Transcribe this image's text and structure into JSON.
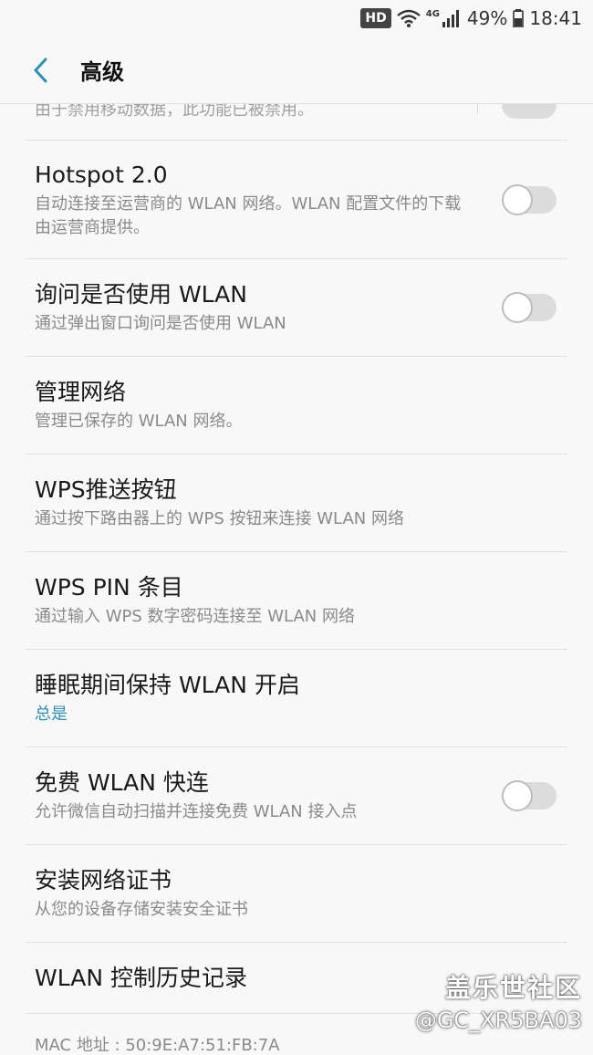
{
  "status_bar": {
    "hd": "HD",
    "network": "4G",
    "battery": "49%",
    "time": "18:41"
  },
  "header": {
    "title": "高级"
  },
  "cut_item": {
    "subtitle": "由于禁用移动数据，此功能已被禁用。"
  },
  "items": [
    {
      "title": "Hotspot 2.0",
      "subtitle": "自动连接至运营商的 WLAN 网络。WLAN 配置文件的下载由运营商提供。",
      "toggle": "off"
    },
    {
      "title": "询问是否使用 WLAN",
      "subtitle": "通过弹出窗口询问是否使用 WLAN",
      "toggle": "off"
    },
    {
      "title": "管理网络",
      "subtitle": "管理已保存的 WLAN 网络。"
    },
    {
      "title": "WPS推送按钮",
      "subtitle": "通过按下路由器上的 WPS 按钮来连接 WLAN 网络"
    },
    {
      "title": "WPS PIN 条目",
      "subtitle": "通过输入 WPS 数字密码连接至 WLAN 网络"
    },
    {
      "title": "睡眠期间保持 WLAN 开启",
      "subtitle": "总是"
    },
    {
      "title": "免费 WLAN 快连",
      "subtitle": "允许微信自动扫描并连接免费 WLAN 接入点",
      "toggle": "off"
    },
    {
      "title": "安装网络证书",
      "subtitle": "从您的设备存储安装安全证书"
    },
    {
      "title": "WLAN 控制历史记录"
    }
  ],
  "mac_address": "MAC 地址 : 50:9E:A7:51:FB:7A",
  "watermark": {
    "line1": "盖乐世社区",
    "line2": "@GC_XR5BA03"
  },
  "colors": {
    "background": "#f8f8f8",
    "accent": "#2f8fb3",
    "divider": "#e2e2e2"
  }
}
